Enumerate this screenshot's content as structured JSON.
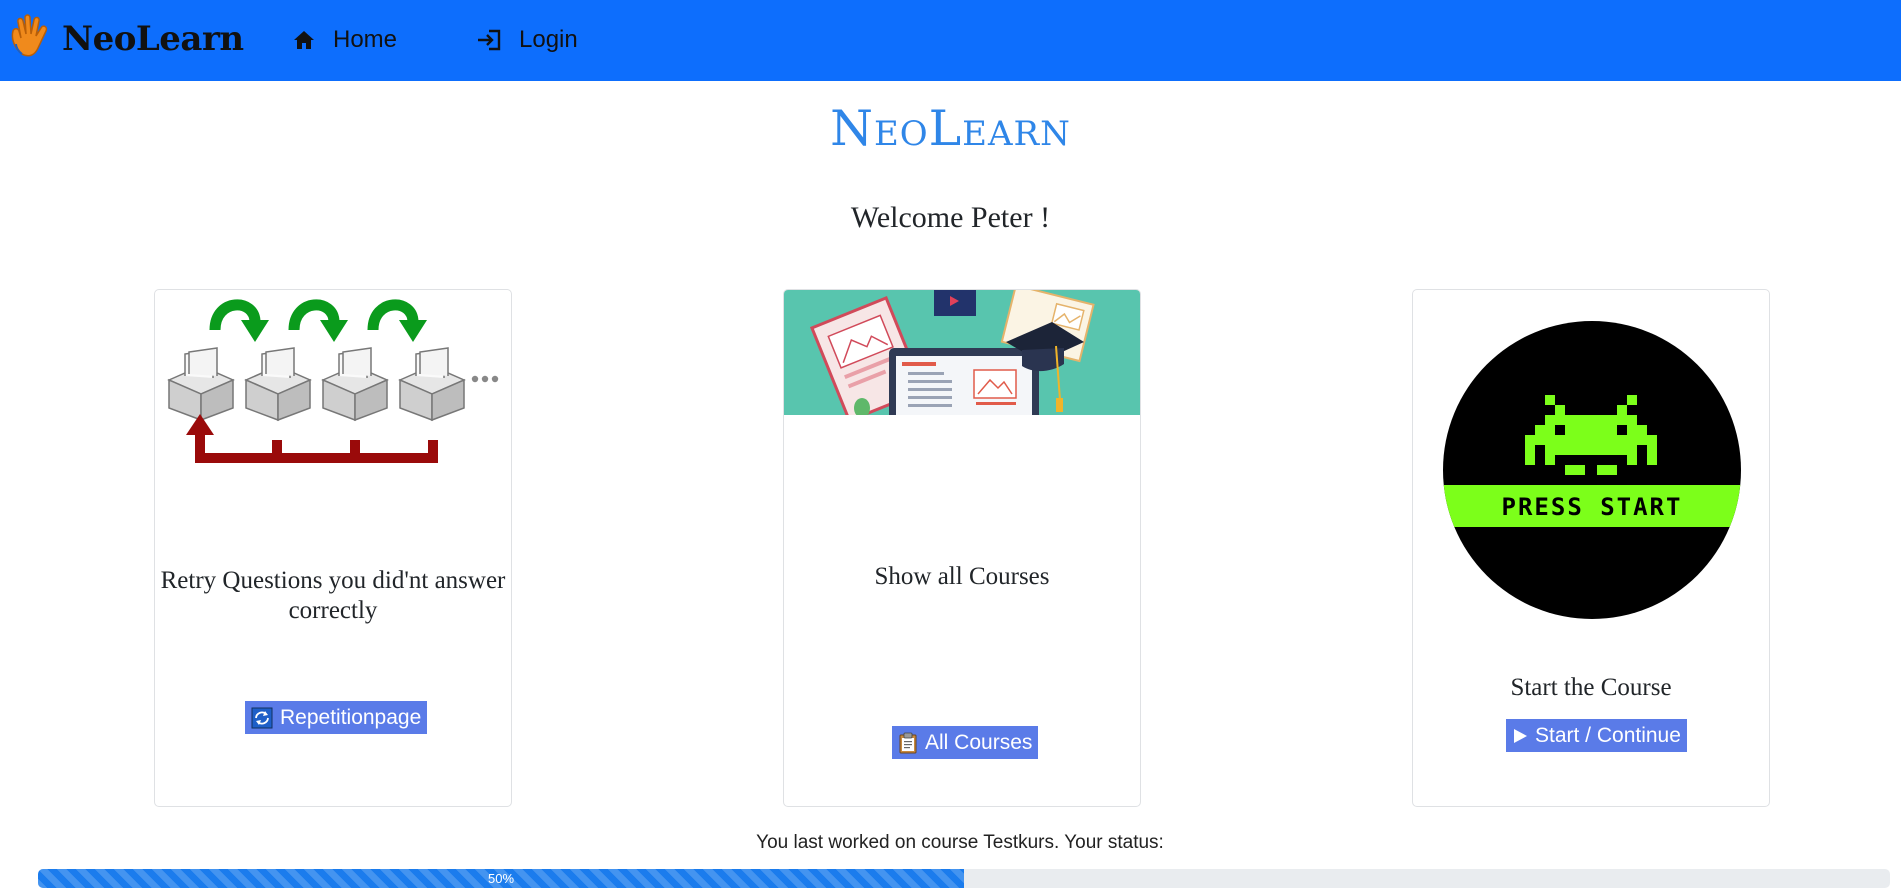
{
  "navbar": {
    "brand": "NeoLearn",
    "links": [
      {
        "label": "Home",
        "icon": "home-icon"
      },
      {
        "label": "Login",
        "icon": "login-icon"
      }
    ]
  },
  "main": {
    "title": "NeoLearn",
    "welcome": "Welcome Peter !"
  },
  "cards": [
    {
      "text": "Retry Questions you did'nt answer correctly",
      "button": "Repetitionpage",
      "button_icon": "repeat-icon",
      "image": "spaced-repetition-boxes-illustration"
    },
    {
      "text": "Show all Courses",
      "button": "All Courses",
      "button_icon": "clipboard-icon",
      "image": "books-and-laptop-illustration"
    },
    {
      "text": "Start the Course",
      "button": "Start / Continue",
      "button_icon": "play-icon",
      "image": "press-start-space-invader-illustration"
    }
  ],
  "status": {
    "text": "You last worked on course Testkurs. Your status:",
    "progress": 50,
    "progress_label": "50%"
  },
  "colors": {
    "navbar": "#0d6efd",
    "title": "#2f86e8",
    "button": "#5a7be8",
    "progress": "#1b7ced"
  }
}
